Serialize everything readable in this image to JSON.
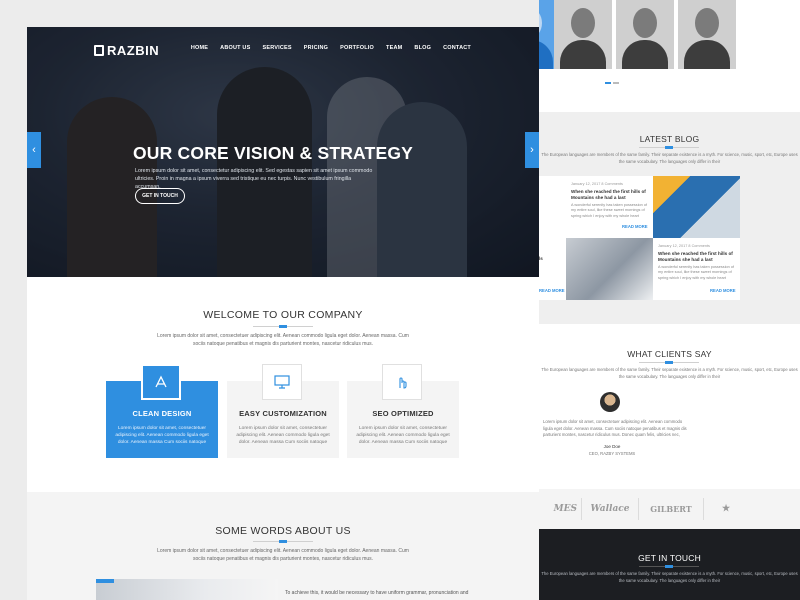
{
  "left": {
    "logo": "RAZBIN",
    "nav": [
      "HOME",
      "ABOUT US",
      "SERVICES",
      "PRICING",
      "PORTFOLIO",
      "TEAM",
      "BLOG",
      "CONTACT"
    ],
    "hero": {
      "title": "OUR CORE VISION & STRATEGY",
      "text": "Lorem ipsum dolor sit amet, consectetur adipiscing elit. Sed egestas sapien sit amet ipsum commodo ultricies. Proin in magna a ipsum viverra sed tristique eu nec turpis. Nunc vestibulum fringilla accumsan.",
      "button": "GET IN TOUCH",
      "prev": "‹",
      "next": "›"
    },
    "welcome": {
      "title": "WELCOME TO OUR COMPANY",
      "text": "Lorem ipsum dolor sit amet, consectetuer adipiscing elit. Aenean commodo ligula eget dolor. Aenean massa. Cum sociis natoque penatibus et magnis dis parturient montes, nascetur ridiculus mus.",
      "features": [
        {
          "title": "CLEAN DESIGN",
          "icon": "clean-design-icon",
          "text": "Lorem ipsum dolor sit amet, consectetuer adipiscing elit. Aenean commodo ligula eget dolor. Aenean massa Cum sociis natoque"
        },
        {
          "title": "EASY CUSTOMIZATION",
          "icon": "monitor-icon",
          "text": "Lorem ipsum dolor sit amet, consectetuer adipiscing elit. Aenean commodo ligula eget dolor. Aenean massa Cum sociis natoque"
        },
        {
          "title": "SEO OPTIMIZED",
          "icon": "hand-pointer-icon",
          "text": "Lorem ipsum dolor sit amet, consectetuer adipiscing elit. Aenean commodo ligula eget dolor. Aenean massa Cum sociis natoque"
        }
      ]
    },
    "about": {
      "title": "SOME WORDS ABOUT US",
      "text": "Lorem ipsum dolor sit amet, consectetuer adipiscing elit. Aenean commodo ligula eget dolor. Aenean massa. Cum sociis natoque penatibus et magnis dis parturient montes, nascetur ridiculus mus.",
      "side_text": "To achieve this, it would be necessary to have uniform grammar, pronunciation and"
    }
  },
  "right": {
    "blog": {
      "title": "LATEST BLOG",
      "text": "The European languages are members of the same family. Their separate existence is a myth. For science, music, sport, etc, Europe uses the same vocabulary. The languages only differ in their",
      "posts": [
        {
          "date": "January 12, 2017  8 Comments",
          "title": "When she reached the first hills of Mountains she had a last",
          "text": "A wonderful serenity has taken possession of my entire soul, like these sweet mornings of spring which I enjoy with my whole heart",
          "more": "READ MORE"
        },
        {
          "date": "January 12, 2017  8 Comments",
          "title": "When she reached the first hills of Mountains she had a last",
          "text": "A wonderful serenity has taken possession of my entire soul, like these sweet mornings of spring which I enjoy with my whole heart",
          "more": "READ MORE"
        }
      ],
      "cut_left_a": "ls",
      "cut_left_b": "READ MORE"
    },
    "clients": {
      "title": "WHAT CLIENTS SAY",
      "text": "The European languages are members of the same family. Their separate existence is a myth. For science, music, sport, etc, Europe uses the same vocabulary. The languages only differ in their",
      "quote": "Lorem ipsum dolor sit amet, consectetuer adipiscing elit. Aenean commodo ligula eget dolor. Aenean massa. Cum sociis natoque penatibus et magnis dis parturient montes, nascetur ridiculus mus. Donec quam felis, ultricies nec, pellentesque eu, pretium quis, sem. Nulla consequat massa quis enim. Donec pede justo, fringilla vel, aliquet nec, vulputate eget, arcu. In enim justo, rhoncus ut, imperdiet a, venenatis vitae, justo. Nullam dictum felis eu pede mollis pretium. Integer tincidunt. Cras dapibus. Vivamus elementum semper nisi. Aenean vulputate eleifend tellus.",
      "name": "Joe Doe",
      "role": "CEO, RAZBY SYSTEMS"
    },
    "logos": [
      "MES",
      "Wallace",
      "GILBERT",
      "★"
    ],
    "touch": {
      "title": "GET IN TOUCH",
      "text": "The European languages are members of the same family. Their separate existence is a myth. For science, music, sport, etc, Europe uses the same vocabulary. The languages only differ in their"
    }
  },
  "colors": {
    "accent": "#2f8fe0",
    "dark": "#1c1e22",
    "light_bg": "#f4f4f4"
  }
}
